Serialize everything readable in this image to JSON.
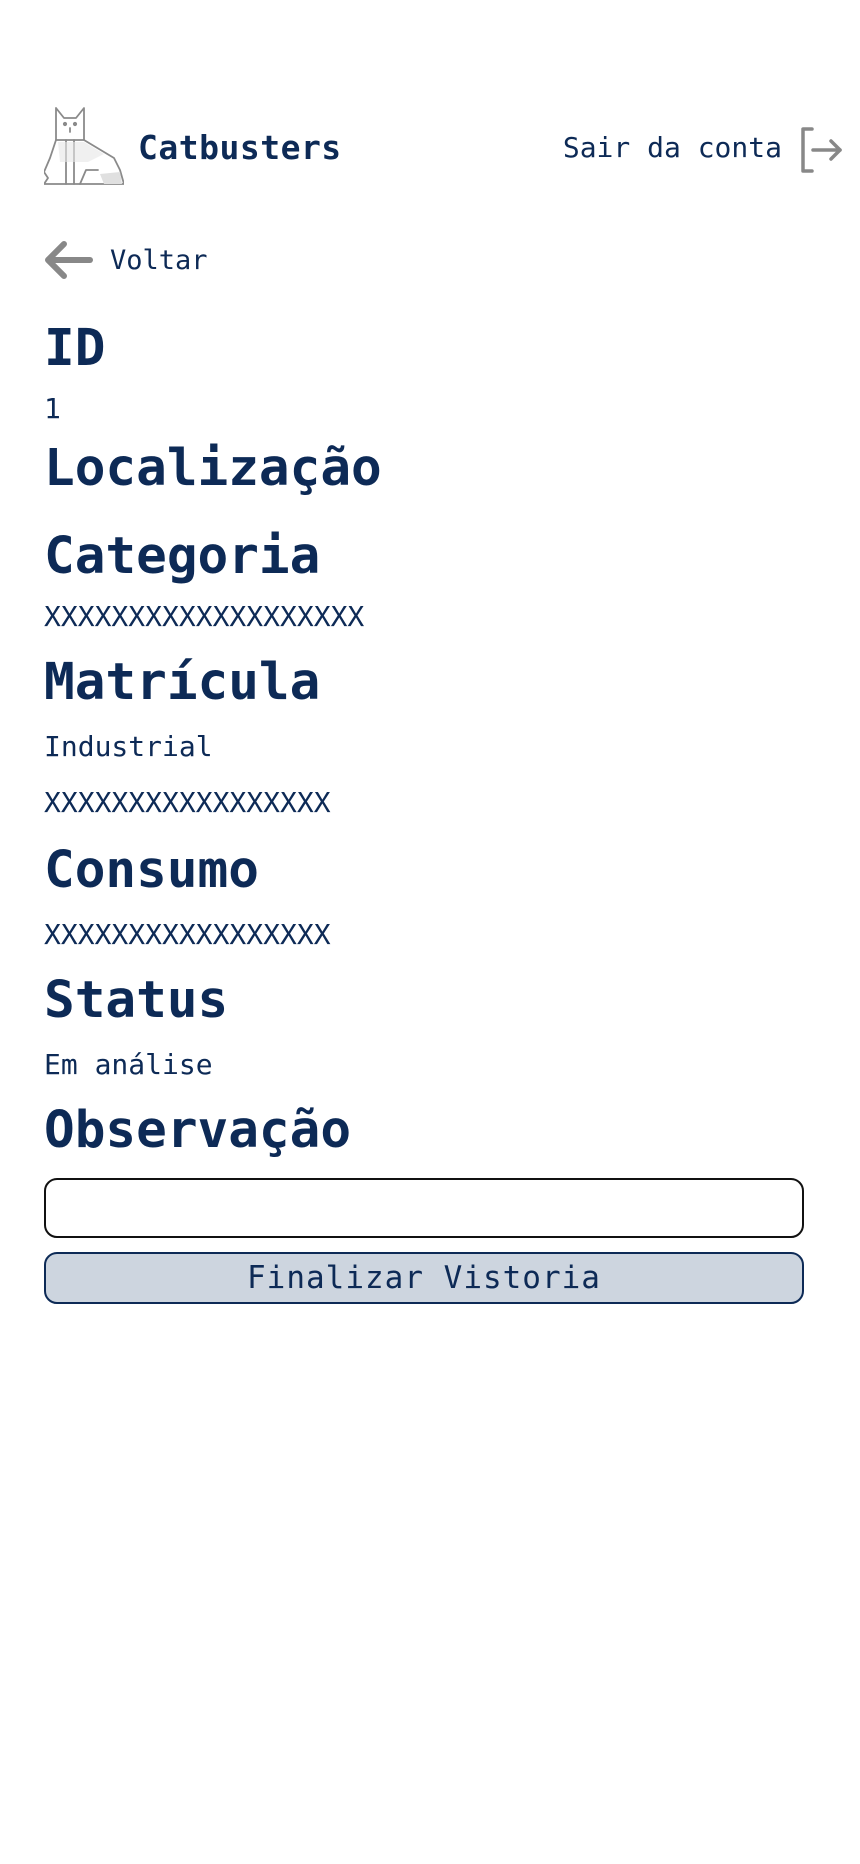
{
  "header": {
    "brand": "Catbusters",
    "logo_icon": "cat-logo-icon",
    "logout_label": "Sair da conta",
    "logout_icon": "logout-icon"
  },
  "nav": {
    "back_label": "Voltar",
    "back_icon": "arrow-left-icon"
  },
  "details": {
    "id_title": "ID",
    "id_value": "1",
    "location_title": "Localização",
    "category_title": "Categoria",
    "category_value": "XXXXXXXXXXXXXXXXXXX",
    "registration_title": "Matrícula",
    "registration_value_1": "Industrial",
    "registration_value_2": "XXXXXXXXXXXXXXXXX",
    "consumption_title": "Consumo",
    "consumption_value": "XXXXXXXXXXXXXXXXX",
    "status_title": "Status",
    "status_value": "Em análise",
    "observation_title": "Observação",
    "observation_value": ""
  },
  "actions": {
    "finish_label": "Finalizar Vistoria"
  },
  "colors": {
    "text_primary": "#0d2a56",
    "button_fill": "#cdd5df",
    "icon_gray": "#888888"
  }
}
